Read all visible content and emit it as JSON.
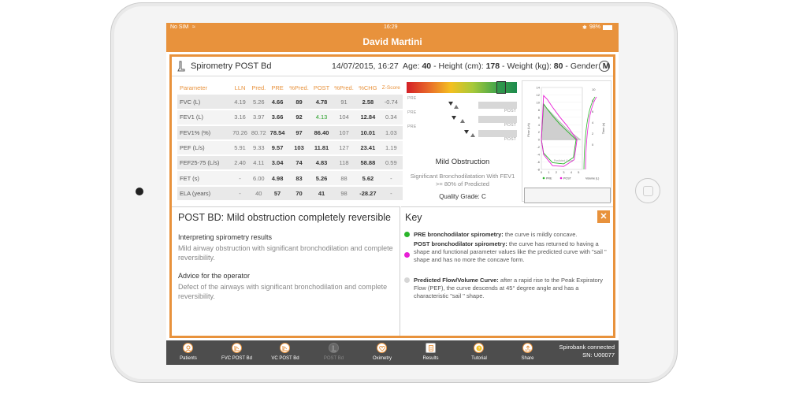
{
  "status_bar": {
    "carrier": "No SIM",
    "time": "16:29",
    "battery": "98%"
  },
  "title_bar": {
    "patient_name": "David Martini"
  },
  "header": {
    "test_name": "Spirometry POST Bd",
    "datetime": "14/07/2015, 16:27",
    "age_label": "Age:",
    "age": "40",
    "height_label": "- Height (cm):",
    "height": "178",
    "weight_label": "- Weight (kg):",
    "weight": "80",
    "gender_label": "- Gender:",
    "gender": "M"
  },
  "table": {
    "headers": [
      "Parameter",
      "LLN",
      "Pred.",
      "PRE",
      "%Pred.",
      "POST",
      "%Pred.",
      "%CHG",
      "Z-Score"
    ],
    "rows": [
      [
        "FVC (L)",
        "4.19",
        "5.26",
        "4.66",
        "89",
        "4.78",
        "91",
        "2.58",
        "-0.74"
      ],
      [
        "FEV1 (L)",
        "3.16",
        "3.97",
        "3.66",
        "92",
        "4.13",
        "104",
        "12.84",
        "0.34"
      ],
      [
        "FEV1% (%)",
        "70.26",
        "80.72",
        "78.54",
        "97",
        "86.40",
        "107",
        "10.01",
        "1.03"
      ],
      [
        "PEF (L/s)",
        "5.91",
        "9.33",
        "9.57",
        "103",
        "11.81",
        "127",
        "23.41",
        "1.19"
      ],
      [
        "FEF25-75 (L/s)",
        "2.40",
        "4.11",
        "3.04",
        "74",
        "4.83",
        "118",
        "58.88",
        "0.59"
      ],
      [
        "FET (s)",
        "-",
        "6.00",
        "4.98",
        "83",
        "5.26",
        "88",
        "5.62",
        "-"
      ],
      [
        "ELA (years)",
        "-",
        "40",
        "57",
        "70",
        "41",
        "98",
        "-28.27",
        "-"
      ]
    ]
  },
  "gauges": [
    {
      "pre_label": "PRE",
      "post_label": "POST",
      "pre_marker": 0.4,
      "post_marker": 0.45
    },
    {
      "pre_label": "PRE",
      "post_label": "POST",
      "pre_marker": 0.43,
      "post_marker": 0.51
    },
    {
      "pre_label": "PRE",
      "post_label": "POST",
      "pre_marker": 0.54,
      "post_marker": 0.6
    }
  ],
  "interpretation": {
    "title": "Mild Obstruction",
    "subtitle": "Significant Bronchodilatation With FEV1 >= 80% of Predicted",
    "quality_grade": "Quality Grade: C"
  },
  "chart_data": {
    "type": "line",
    "y_ticks": [
      "14",
      "12",
      "10",
      "8",
      "6",
      "4",
      "2",
      "0",
      "-2",
      "-4",
      "-6",
      "-8"
    ],
    "x_ticks": [
      "0",
      "1",
      "2",
      "3",
      "4",
      "5"
    ],
    "right_ticks": [
      "10",
      "8",
      "6",
      "4",
      "2",
      "0"
    ],
    "ylabel": "Flow (L/s)",
    "right_label": "Time (s)",
    "legend": [
      "PRE",
      "POST",
      "Volume (L)"
    ],
    "watermark": "Predicted Curve",
    "series": [
      {
        "name": "PRE",
        "x": [
          0,
          0.3,
          0.8,
          1.5,
          2.5,
          3.5,
          4.66,
          4.3,
          3,
          1.5,
          0.3,
          0
        ],
        "y": [
          0,
          9.57,
          8.2,
          6.4,
          4.1,
          2.2,
          0,
          -4.8,
          -6.5,
          -6.2,
          -3.6,
          0
        ]
      },
      {
        "name": "POST",
        "x": [
          0,
          0.3,
          0.8,
          1.5,
          2.5,
          3.5,
          4.78,
          4.4,
          3,
          1.5,
          0.3,
          0
        ],
        "y": [
          0,
          11.81,
          10.8,
          8.7,
          6,
          3.6,
          0,
          -5.4,
          -7.2,
          -7,
          -4,
          0
        ]
      },
      {
        "name": "Predicted",
        "x": [
          0,
          0.3,
          1.2,
          2.4,
          3.6,
          5.26
        ],
        "y": [
          0,
          9.33,
          7.5,
          5,
          2.6,
          0
        ]
      }
    ],
    "colors": {
      "PRE": "#2ab52a",
      "POST": "#e81fd6",
      "Predicted": "#9e9e9e"
    }
  },
  "summary": {
    "title": "POST BD: Mild obstruction completely reversible",
    "interpreting_heading": "Interpreting spirometry results",
    "interpreting_body": "Mild airway obstruction with significant bronchodilation and complete reversibility.",
    "advice_heading": "Advice for the operator",
    "advice_body": "Defect of the airways with significant bronchodilation and complete reversibility."
  },
  "key": {
    "title": "Key",
    "close_icon": "close-icon",
    "items": [
      {
        "color": "#2ab52a",
        "bold": "PRE bronchodilator spirometry:",
        "text": " the curve is mildly concave."
      },
      {
        "color": "#e81fd6",
        "bold": "POST bronchodilator spirometry:",
        "text": " the curve has returned to having a shape and functional parameter values like the predicted curve with \"sail \" shape and has no more the concave form."
      },
      {
        "color": "#d6d6d6",
        "bold": "Predicted Flow/Volume Curve:",
        "text": " after a rapid rise to the Peak Expiratory Flow (PEF), the curve descends at 45° degree angle and has a characteristic \"sail \" shape."
      }
    ]
  },
  "tabbar": {
    "tabs": [
      {
        "label": "Patients",
        "icon": "patients-icon",
        "state": "normal"
      },
      {
        "label": "FVC POST Bd",
        "icon": "chart-icon",
        "state": "normal"
      },
      {
        "label": "VC POST Bd",
        "icon": "chart-icon",
        "state": "normal"
      },
      {
        "label": "POST Bd",
        "icon": "lungs-icon",
        "state": "disabled"
      },
      {
        "label": "Oximetry",
        "icon": "heart-icon",
        "state": "normal"
      },
      {
        "label": "Results",
        "icon": "results-icon",
        "state": "active"
      },
      {
        "label": "Tutorial",
        "icon": "help-icon",
        "state": "normal"
      },
      {
        "label": "Share",
        "icon": "share-icon",
        "state": "normal"
      }
    ],
    "device_status": "Spirobank connected",
    "serial": "SN: U00077"
  }
}
